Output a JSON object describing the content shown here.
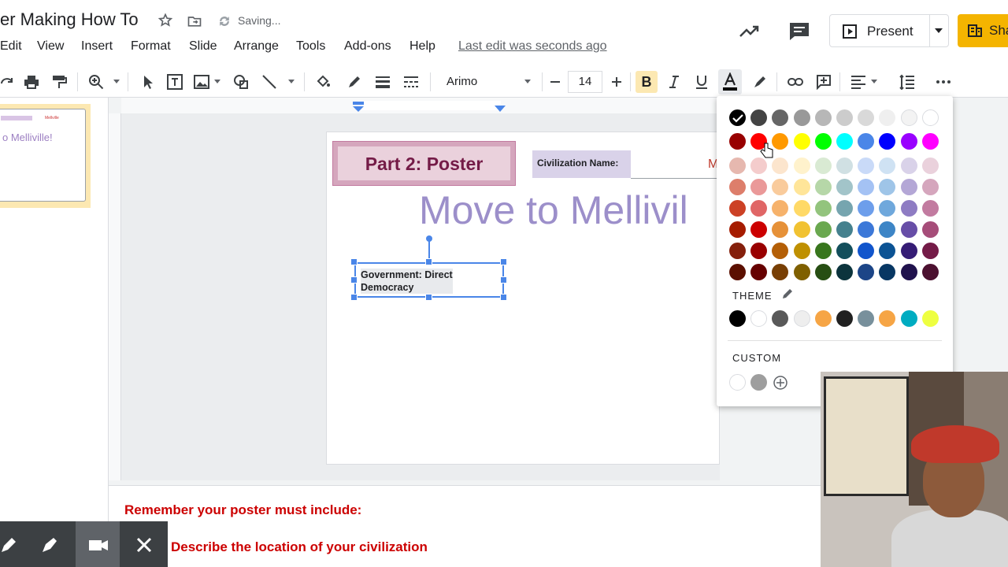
{
  "header": {
    "doc_title": "er Making How To",
    "status": "Saving...",
    "menu": [
      "Edit",
      "View",
      "Insert",
      "Format",
      "Slide",
      "Arrange",
      "Tools",
      "Add-ons",
      "Help"
    ],
    "last_edit": "Last edit was seconds ago",
    "present_label": "Present",
    "share_label": "Sha"
  },
  "toolbar": {
    "font_name": "Arimo",
    "font_size": "14",
    "bold_label": "B"
  },
  "filmstrip": {
    "thumb_title": "o Melliville!",
    "thumb_small": "Mellville"
  },
  "slide": {
    "title": "Part 2: Poster",
    "civ_label": "Civilization Name:",
    "civ_value_partial": "M",
    "big_title": "Move to Mellivil",
    "gov_text_line1": "Government: Direct",
    "gov_text_line2": "Democracy"
  },
  "notes": {
    "line1": "Remember your poster must include:",
    "line2": "Describe the location of your civilization"
  },
  "palette": {
    "theme_label": "THEME",
    "custom_label": "CUSTOM",
    "selected": "#000000",
    "rows": [
      [
        "#000000",
        "#434343",
        "#666666",
        "#999999",
        "#b7b7b7",
        "#cccccc",
        "#d9d9d9",
        "#efefef",
        "#f3f3f3",
        "#ffffff"
      ],
      [
        "#980000",
        "#ff0000",
        "#ff9900",
        "#ffff00",
        "#00ff00",
        "#00ffff",
        "#4a86e8",
        "#0000ff",
        "#9900ff",
        "#ff00ff"
      ],
      [
        "#e6b8af",
        "#f4cccc",
        "#fce5cd",
        "#fff2cc",
        "#d9ead3",
        "#d0e0e3",
        "#c9daf8",
        "#cfe2f3",
        "#d9d2e9",
        "#ead1dc"
      ],
      [
        "#dd7e6b",
        "#ea9999",
        "#f9cb9c",
        "#ffe599",
        "#b6d7a8",
        "#a2c4c9",
        "#a4c2f4",
        "#9fc5e8",
        "#b4a7d6",
        "#d5a6bd"
      ],
      [
        "#cc4125",
        "#e06666",
        "#f6b26b",
        "#ffd966",
        "#93c47d",
        "#76a5af",
        "#6d9eeb",
        "#6fa8dc",
        "#8e7cc3",
        "#c27ba0"
      ],
      [
        "#a61c00",
        "#cc0000",
        "#e69138",
        "#f1c232",
        "#6aa84f",
        "#45818e",
        "#3c78d8",
        "#3d85c6",
        "#674ea7",
        "#a64d79"
      ],
      [
        "#85200c",
        "#990000",
        "#b45f06",
        "#bf9000",
        "#38761d",
        "#134f5c",
        "#1155cc",
        "#0b5394",
        "#351c75",
        "#741b47"
      ],
      [
        "#5b0f00",
        "#660000",
        "#783f04",
        "#7f6000",
        "#274e13",
        "#0c343d",
        "#1c4587",
        "#073763",
        "#20124d",
        "#4c1130"
      ]
    ],
    "theme": [
      "#000000",
      "#ffffff",
      "#595959",
      "#eeeeee",
      "#f6a545",
      "#212121",
      "#78909c",
      "#f6a545",
      "#00acc1",
      "#eeff41"
    ],
    "custom": [
      "#ffffff",
      "#9e9e9e"
    ]
  },
  "icons": [
    "star-icon",
    "move-to-folder-icon",
    "sync-icon",
    "activity-icon",
    "comments-icon",
    "present-icon",
    "share-icon",
    "redo-icon",
    "print-icon",
    "paint-format-icon",
    "zoom-icon",
    "select-icon",
    "textbox-icon",
    "image-icon",
    "shape-icon",
    "line-icon",
    "fill-color-icon",
    "border-color-icon",
    "border-weight-icon",
    "border-dash-icon",
    "italic-icon",
    "underline-icon",
    "text-color-icon",
    "highlight-icon",
    "link-icon",
    "comment-add-icon",
    "align-icon",
    "line-spacing-icon",
    "more-icon",
    "edit-icon"
  ]
}
